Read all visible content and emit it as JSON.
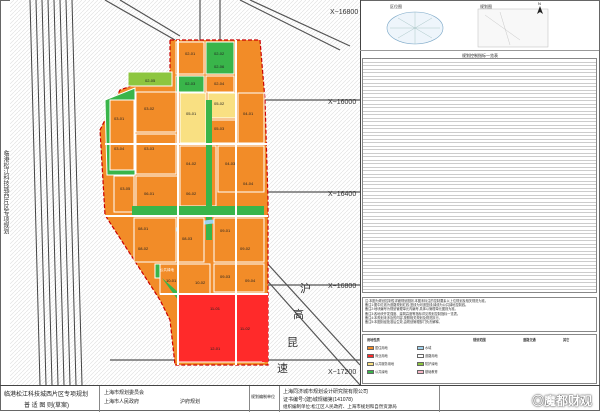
{
  "map": {
    "coords": {
      "c1": "X−16800",
      "c2": "X−16000",
      "c3": "X−16400",
      "c4": "X−16800",
      "c5": "X−17200"
    },
    "expressway": [
      "沪",
      "高",
      "昆",
      "速"
    ],
    "parcels": [
      {
        "id": "02-01",
        "use": "green"
      },
      {
        "id": "02-02",
        "use": "green"
      },
      {
        "id": "02-03",
        "use": "residential"
      },
      {
        "id": "02-04",
        "use": "residential"
      },
      {
        "id": "02-05",
        "use": "residential"
      },
      {
        "id": "02-06",
        "use": "green"
      },
      {
        "id": "03-01",
        "use": "residential"
      },
      {
        "id": "03-02",
        "use": "residential"
      },
      {
        "id": "03-03",
        "use": "residential"
      },
      {
        "id": "03-04",
        "use": "residential"
      },
      {
        "id": "03-05",
        "use": "residential"
      },
      {
        "id": "04-01",
        "use": "residential"
      },
      {
        "id": "04-02",
        "use": "residential"
      },
      {
        "id": "04-03",
        "use": "residential"
      },
      {
        "id": "04-04",
        "use": "residential"
      },
      {
        "id": "05-01",
        "use": "public"
      },
      {
        "id": "05-02",
        "use": "public"
      },
      {
        "id": "05-03",
        "use": "public"
      },
      {
        "id": "05-04",
        "use": "public"
      },
      {
        "id": "06-01",
        "use": "residential"
      },
      {
        "id": "06-02",
        "use": "residential"
      },
      {
        "id": "06-03",
        "use": "residential"
      },
      {
        "id": "08-01",
        "use": "residential"
      },
      {
        "id": "08-02",
        "use": "residential"
      },
      {
        "id": "08-03",
        "use": "residential"
      },
      {
        "id": "08-04",
        "use": "residential"
      },
      {
        "id": "09-01",
        "use": "residential"
      },
      {
        "id": "09-02",
        "use": "residential"
      },
      {
        "id": "09-03",
        "use": "residential"
      },
      {
        "id": "09-04",
        "use": "residential"
      },
      {
        "id": "10-01",
        "use": "residential"
      },
      {
        "id": "10-02",
        "use": "residential"
      },
      {
        "id": "10-03",
        "use": "green"
      },
      {
        "id": "11-01",
        "use": "commercial"
      },
      {
        "id": "11-02",
        "use": "commercial"
      },
      {
        "id": "12-01",
        "use": "commercial"
      }
    ],
    "green_tile_label": "公共绿地"
  },
  "right": {
    "thumb_left_label": "区位图",
    "thumb_right_label": "规划图",
    "compass": "N",
    "table_title": "规划控制指标一览表",
    "notes": [
      "注:本图为规划控制性详细规划图则,本图未标注的控制要素以上位规划及相关规范为准。",
      "备注1:图中红线为道路规划红线;蓝线为河道蓝线;绿线为公共绿地控制线。",
      "备注2:地块编号为规划管理单元内编号,具体以管理单元图则为准。",
      "备注3:各地块开发强度、建筑高度等指标详见规划控制指标一览表。",
      "备注4:本规划未涉及的内容,按照相关规划及规范执行。",
      "备注5:本图则经批准后生效,由规划管理部门负责解释。"
    ],
    "legend": {
      "title1": "用地性质",
      "title2": "规划范围",
      "title3": "道路交通",
      "title4": "其它",
      "items": [
        {
          "label": "居住用地",
          "color": "#f28c28"
        },
        {
          "label": "商业用地",
          "color": "#ff2a2a"
        },
        {
          "label": "公共服务用地",
          "color": "#f9e082"
        },
        {
          "label": "公共绿地",
          "color": "#39b54a"
        },
        {
          "label": "水域",
          "color": "#9fd3ef"
        },
        {
          "label": "道路用地",
          "color": "#ffffff"
        },
        {
          "label": "防护绿地",
          "color": "#8dc63f"
        },
        {
          "label": "基础教育",
          "color": "#f7b7c7"
        }
      ]
    }
  },
  "bottom": {
    "title1": "临港松江科技城西片区专项规划",
    "title2": "普 适 图 则(草案)",
    "org1": "上海市规划委员会",
    "org2": "上海市人民政府",
    "org3": "沪府规划",
    "org4": "规划编制单位",
    "org5": "上海同济城市规划设计研究院有限公司",
    "org6": "证书编号:(建)城规编第(141078)",
    "org7": "组织编制单位:松江区人民政府、上海市规划和自然资源局",
    "watermark": "◎魔都财观"
  }
}
